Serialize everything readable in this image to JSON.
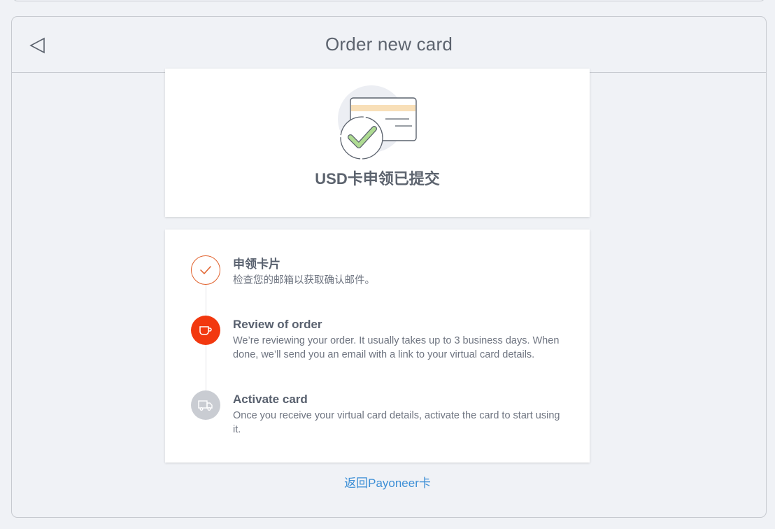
{
  "header": {
    "title": "Order new card"
  },
  "status": {
    "title": "USD卡申领已提交"
  },
  "steps": [
    {
      "title": "申领卡片",
      "description": "检查您的邮箱以获取确认邮件。",
      "state": "done",
      "icon": "check-icon"
    },
    {
      "title": "Review of order",
      "description": "We’re reviewing your order. It usually takes up to 3 business days. When done, we’ll send you an email with a link to your virtual card details.",
      "state": "active",
      "icon": "coffee-cup-icon"
    },
    {
      "title": "Activate card",
      "description": "Once you receive your virtual card details, activate the card to start using it.",
      "state": "pending",
      "icon": "truck-icon"
    }
  ],
  "footer": {
    "return_link": "返回Payoneer卡"
  },
  "colors": {
    "done": "#e1612c",
    "active": "#f2380f",
    "pending": "#c9ccd2",
    "link": "#3d8fd6"
  }
}
